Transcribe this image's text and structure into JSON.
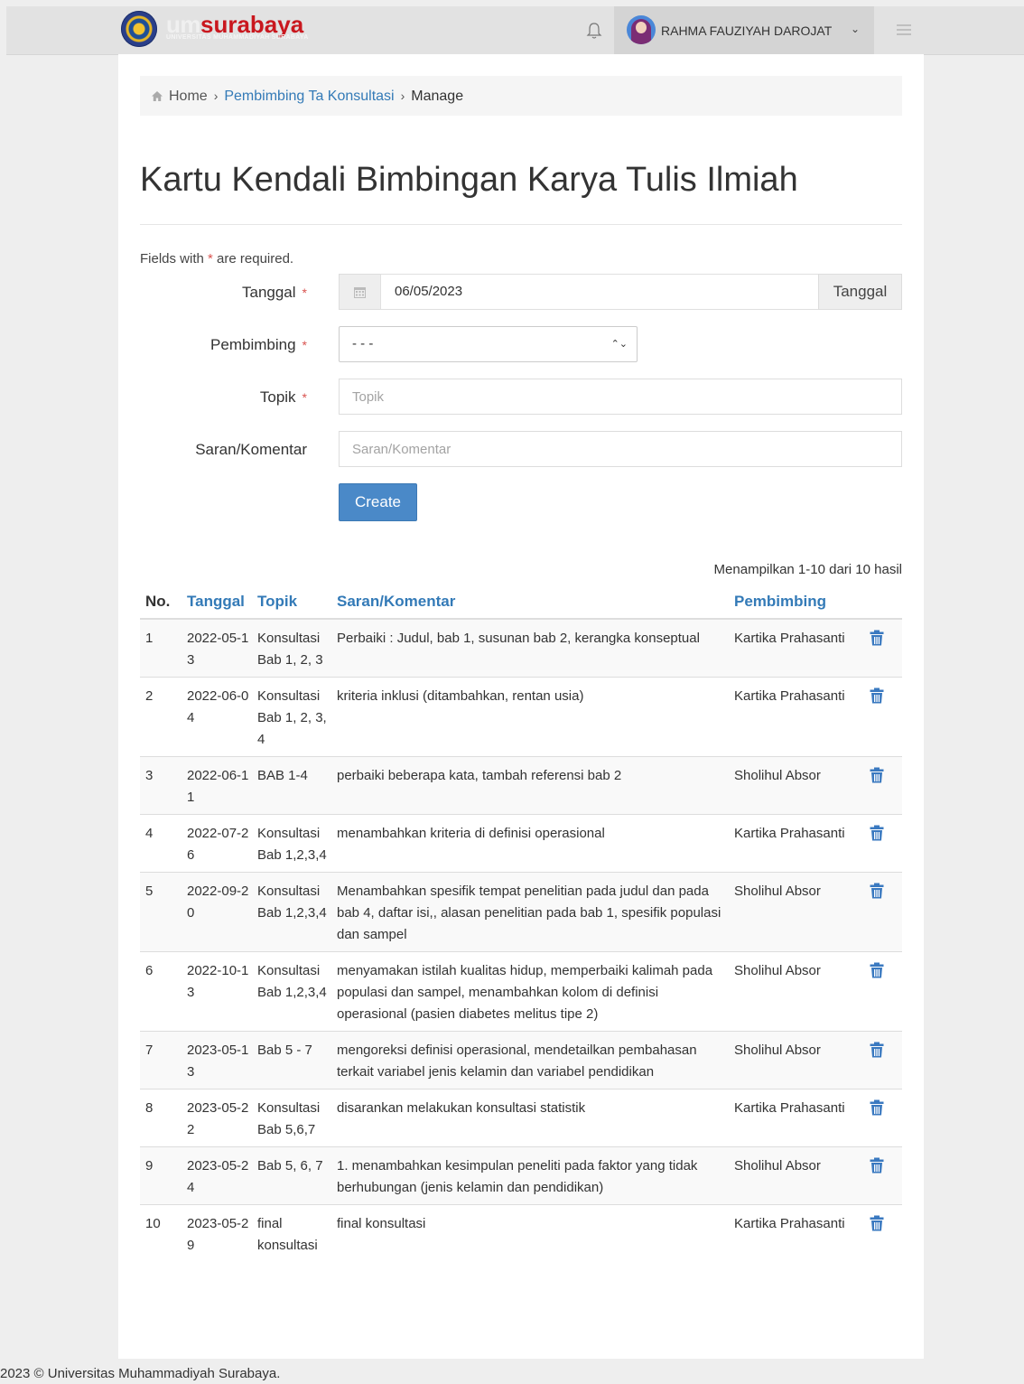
{
  "header": {
    "logo_um": "um",
    "logo_surabaya": "surabaya",
    "logo_sub": "UNIVERSITAS MUHAMMADIYAH SURABAYA",
    "user_name": "RAHMA FAUZIYAH DAROJAT",
    "icons": [
      "bell-icon",
      "chevron-down-icon",
      "menu-icon"
    ]
  },
  "breadcrumb": {
    "home": "Home",
    "section": "Pembimbing Ta Konsultasi",
    "current": "Manage",
    "separator": "›"
  },
  "page_title": "Kartu Kendali Bimbingan Karya Tulis Ilmiah",
  "form": {
    "required_note_prefix": "Fields with",
    "required_star": "*",
    "required_note_suffix": "are required.",
    "tanggal_label": "Tanggal",
    "tanggal_value": "06/05/2023",
    "tanggal_addon": "Tanggal",
    "pembimbing_label": "Pembimbing",
    "pembimbing_value": "- - -",
    "topik_label": "Topik",
    "topik_placeholder": "Topik",
    "saran_label": "Saran/Komentar",
    "saran_placeholder": "Saran/Komentar",
    "create_label": "Create"
  },
  "table": {
    "summary": "Menampilkan 1-10 dari 10 hasil",
    "headers": [
      "No.",
      "Tanggal",
      "Topik",
      "Saran/Komentar",
      "Pembimbing"
    ],
    "rows": [
      {
        "no": "1",
        "tanggal": "2022-05-13",
        "topik": "Konsultasi Bab 1, 2, 3",
        "saran": "Perbaiki : Judul, bab 1, susunan bab 2, kerangka konseptual",
        "pembimbing": "Kartika Prahasanti"
      },
      {
        "no": "2",
        "tanggal": "2022-06-04",
        "topik": "Konsultasi Bab 1, 2, 3, 4",
        "saran": "kriteria inklusi (ditambahkan, rentan usia)",
        "pembimbing": "Kartika Prahasanti"
      },
      {
        "no": "3",
        "tanggal": "2022-06-11",
        "topik": "BAB 1-4",
        "saran": "perbaiki beberapa kata, tambah referensi bab 2",
        "pembimbing": "Sholihul Absor"
      },
      {
        "no": "4",
        "tanggal": "2022-07-26",
        "topik": "Konsultasi Bab 1,2,3,4",
        "saran": "menambahkan kriteria di definisi operasional",
        "pembimbing": "Kartika Prahasanti"
      },
      {
        "no": "5",
        "tanggal": "2022-09-20",
        "topik": "Konsultasi Bab 1,2,3,4",
        "saran": "Menambahkan spesifik tempat penelitian pada judul dan pada bab 4, daftar isi,, alasan penelitian pada bab 1, spesifik populasi dan sampel",
        "pembimbing": "Sholihul Absor"
      },
      {
        "no": "6",
        "tanggal": "2022-10-13",
        "topik": "Konsultasi Bab 1,2,3,4",
        "saran": "menyamakan istilah kualitas hidup, memperbaiki kalimah pada populasi dan sampel, menambahkan kolom di definisi operasional (pasien diabetes melitus tipe 2)",
        "pembimbing": "Sholihul Absor"
      },
      {
        "no": "7",
        "tanggal": "2023-05-13",
        "topik": "Bab 5 - 7",
        "saran": "mengoreksi definisi operasional, mendetailkan pembahasan terkait variabel jenis kelamin dan variabel pendidikan",
        "pembimbing": "Sholihul Absor"
      },
      {
        "no": "8",
        "tanggal": "2023-05-22",
        "topik": "Konsultasi Bab 5,6,7",
        "saran": "disarankan melakukan konsultasi statistik",
        "pembimbing": "Kartika Prahasanti"
      },
      {
        "no": "9",
        "tanggal": "2023-05-24",
        "topik": "Bab 5, 6, 7",
        "saran": "1. menambahkan kesimpulan peneliti pada faktor yang tidak berhubungan (jenis kelamin dan pendidikan)",
        "pembimbing": "Sholihul Absor"
      },
      {
        "no": "10",
        "tanggal": "2023-05-29",
        "topik": "final konsultasi",
        "saran": "final konsultasi",
        "pembimbing": "Kartika Prahasanti"
      }
    ]
  },
  "footer": "2023 © Universitas Muhammadiyah Surabaya.",
  "colors": {
    "link": "#337ab7",
    "required": "#d9534f",
    "button": "#4a89c8",
    "brand_red": "#c9171e"
  }
}
